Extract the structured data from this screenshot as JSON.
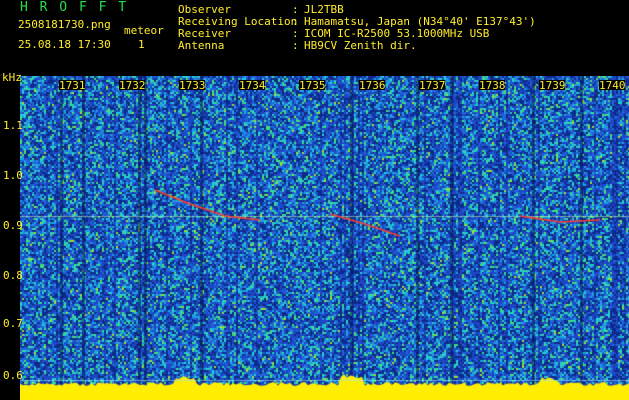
{
  "header": {
    "brand": "H R O F F T",
    "filename": "2508181730.png",
    "datetime": "25.08.18 17:30",
    "type_label": "meteor",
    "count": "1"
  },
  "station": {
    "rows": [
      {
        "label": "Observer",
        "value": "JL2TBB"
      },
      {
        "label": "Receiving Location",
        "value": "Hamamatsu, Japan (N34°40' E137°43')"
      },
      {
        "label": "Receiver",
        "value": "ICOM IC-R2500 53.1000MHz USB"
      },
      {
        "label": "Antenna",
        "value": "HB9CV Zenith dir."
      }
    ]
  },
  "y_axis": {
    "unit": "kHz",
    "ticks": [
      "1.1",
      "1.0",
      "0.9",
      "0.8",
      "0.7",
      "0.6"
    ]
  },
  "x_axis": {
    "ticks": [
      "1731",
      "1732",
      "1733",
      "1734",
      "1735",
      "1736",
      "1737",
      "1738",
      "1739",
      "1740"
    ]
  },
  "colors": {
    "text_green": "#22e04a",
    "text_yellow": "#ffee2a",
    "spectrogram_bg": "#1c3fb0",
    "noise_high": "#2ad0c8",
    "signal": "#ff3a2a",
    "baseline": "#ffee00"
  }
}
